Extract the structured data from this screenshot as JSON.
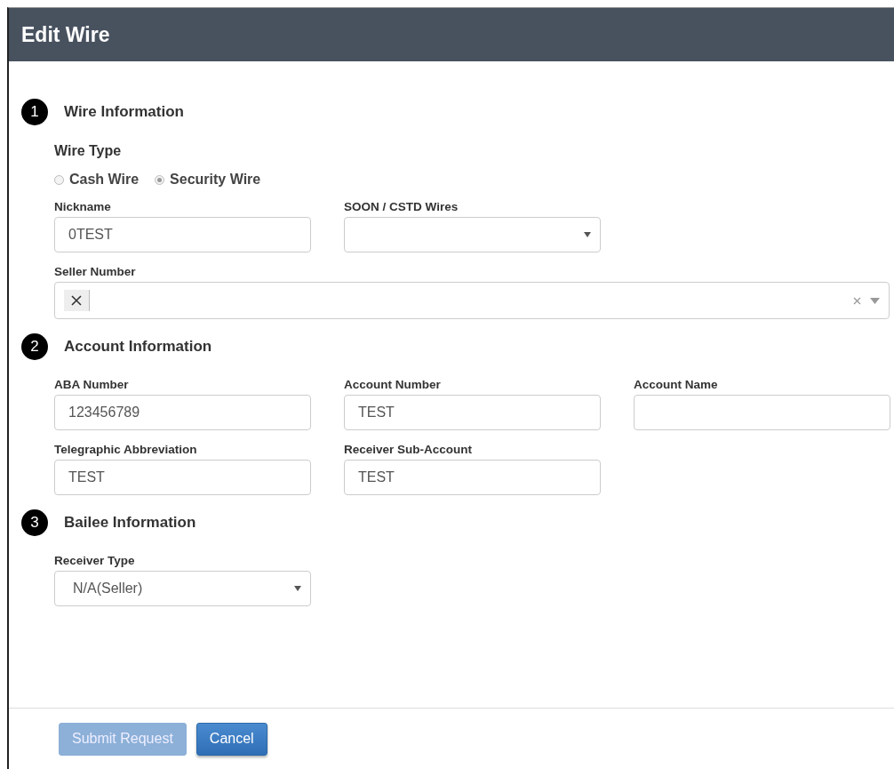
{
  "dialog": {
    "title": "Edit Wire"
  },
  "sections": [
    {
      "number": "1",
      "title": "Wire Information",
      "radio_group": {
        "label": "Wire Type",
        "options": [
          {
            "label": "Cash Wire",
            "selected": false
          },
          {
            "label": "Security Wire",
            "selected": true
          }
        ]
      },
      "rows": [
        [
          {
            "kind": "text",
            "label": "Nickname",
            "value": "0TEST"
          },
          {
            "kind": "select",
            "label": "SOON / CSTD  Wires"
          }
        ],
        [
          {
            "kind": "multiselect",
            "label": "Seller Number"
          }
        ]
      ]
    },
    {
      "number": "2",
      "title": "Account Information",
      "rows": [
        [
          {
            "kind": "text",
            "label": "ABA Number",
            "value": "123456789"
          },
          {
            "kind": "text",
            "label": "Account Number",
            "value": "TEST"
          },
          {
            "kind": "text",
            "label": "Account Name"
          }
        ],
        [
          {
            "kind": "text",
            "label": "Telegraphic Abbreviation",
            "value": "TEST"
          },
          {
            "kind": "text",
            "label": "Receiver Sub-Account",
            "value": "TEST"
          }
        ]
      ]
    },
    {
      "number": "3",
      "title": "Bailee Information",
      "rows": [
        [
          {
            "kind": "select",
            "label": "Receiver Type",
            "value": "N/A(Seller)"
          }
        ]
      ]
    }
  ],
  "buttons": [
    {
      "label": "Submit Request",
      "disabled": true
    },
    {
      "label": "Cancel",
      "disabled": false
    }
  ]
}
